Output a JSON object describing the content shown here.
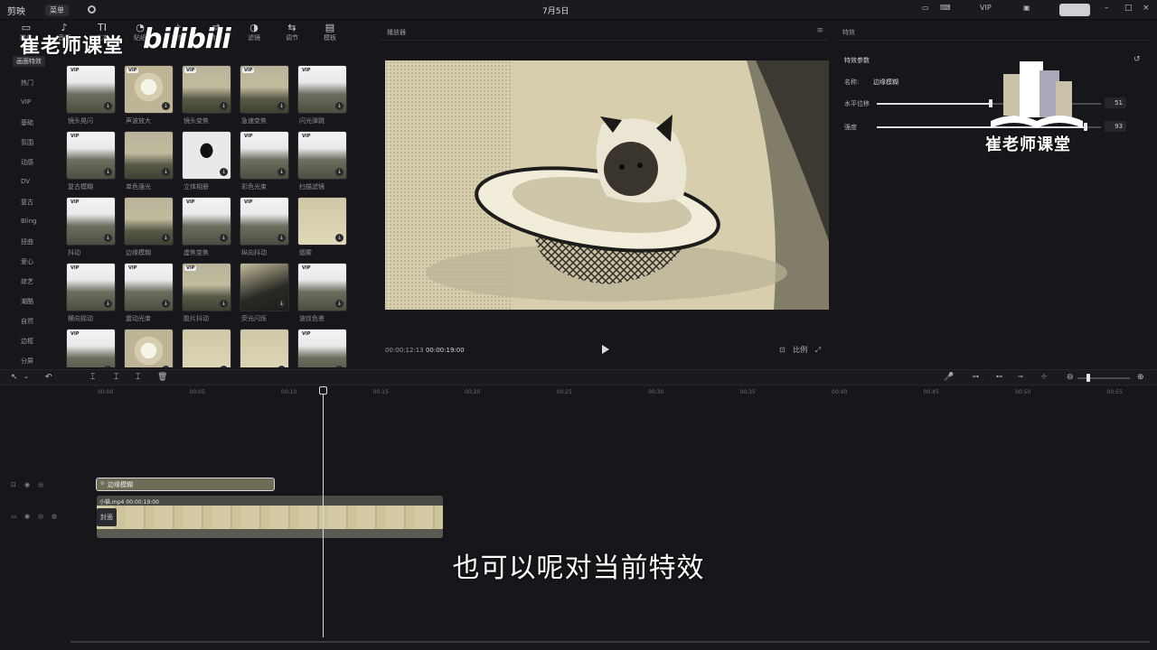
{
  "titlebar": {
    "app_name": "剪映",
    "menu_label": "菜单",
    "window_title": "7月5日",
    "vip_label": "VIP",
    "export_label": "",
    "minimize": "–",
    "maximize": "□",
    "close": "×"
  },
  "toolbar_tabs": [
    {
      "label": "媒体",
      "icon": "▭"
    },
    {
      "label": "音频",
      "icon": "♪"
    },
    {
      "label": "文本",
      "icon": "TI"
    },
    {
      "label": "贴纸",
      "icon": "◔"
    },
    {
      "label": "特效",
      "icon": "✧"
    },
    {
      "label": "转场",
      "icon": "⇄"
    },
    {
      "label": "滤镜",
      "icon": "◑"
    },
    {
      "label": "调节",
      "icon": "⇆"
    },
    {
      "label": "模板",
      "icon": "▤"
    }
  ],
  "watermark": {
    "left_text": "崔老师课堂",
    "bilibili": "bilibili",
    "right_text": "崔老师课堂"
  },
  "effects_nav": {
    "active": "画面特效",
    "items": [
      "热门",
      "VIP",
      "基础",
      "氛围",
      "动感",
      "DV",
      "复古",
      "Bling",
      "扭曲",
      "爱心",
      "综艺",
      "潮酷",
      "自然",
      "边框",
      "分屏"
    ]
  },
  "effect_cards": [
    {
      "name": "镜头晃闪",
      "vip": true,
      "thumb": "t-forest"
    },
    {
      "name": "声波放大",
      "vip": true,
      "thumb": "t-girl"
    },
    {
      "name": "镜头变焦",
      "vip": true,
      "thumb": "t-warm"
    },
    {
      "name": "急速变焦",
      "vip": true,
      "thumb": "t-warm"
    },
    {
      "name": "闪光弹跳",
      "vip": true,
      "thumb": "t-forest"
    },
    {
      "name": "复古模糊",
      "vip": true,
      "thumb": "t-forest"
    },
    {
      "name": "单色强光",
      "vip": false,
      "thumb": "t-warm"
    },
    {
      "name": "立体相册",
      "vip": false,
      "thumb": "t-bw"
    },
    {
      "name": "彩色光束",
      "vip": true,
      "thumb": "t-forest"
    },
    {
      "name": "扫描滤镜",
      "vip": true,
      "thumb": "t-forest"
    },
    {
      "name": "抖动",
      "vip": true,
      "thumb": "t-forest"
    },
    {
      "name": "边缘模糊",
      "vip": false,
      "thumb": "t-warm"
    },
    {
      "name": "虚焦变焦",
      "vip": true,
      "thumb": "t-forest"
    },
    {
      "name": "纵向抖动",
      "vip": true,
      "thumb": "t-forest"
    },
    {
      "name": "烟雾",
      "vip": false,
      "thumb": "t-cream"
    },
    {
      "name": "横向摇动",
      "vip": true,
      "thumb": "t-forest"
    },
    {
      "name": "震动光束",
      "vip": true,
      "thumb": "t-forest"
    },
    {
      "name": "胶片抖动",
      "vip": true,
      "thumb": "t-warm"
    },
    {
      "name": "荧光闪烁",
      "vip": false,
      "thumb": "t-dark"
    },
    {
      "name": "波纹色差",
      "vip": true,
      "thumb": "t-forest"
    },
    {
      "name": "",
      "vip": true,
      "thumb": "t-forest"
    },
    {
      "name": "",
      "vip": false,
      "thumb": "t-girl"
    },
    {
      "name": "",
      "vip": false,
      "thumb": "t-cream"
    },
    {
      "name": "",
      "vip": false,
      "thumb": "t-cream"
    },
    {
      "name": "",
      "vip": true,
      "thumb": "t-forest"
    }
  ],
  "player": {
    "title": "播放器",
    "menu_icon": "≡",
    "current_time": "00:00:12:13",
    "total_time": "00:00:19:00",
    "ratio_label": "比例"
  },
  "inspector": {
    "title": "特效",
    "section": "特效参数",
    "name_label": "名称:",
    "name_value": "边缘模糊",
    "params": [
      {
        "label": "水平位移",
        "value": "51",
        "level": 0.51
      },
      {
        "label": "强度",
        "value": "93",
        "level": 0.93
      }
    ]
  },
  "timeline": {
    "ticks": [
      "00:00",
      "00:05",
      "00:10",
      "00:15",
      "00:20",
      "00:25",
      "00:30",
      "00:35",
      "00:40",
      "00:45",
      "00:50",
      "00:55"
    ],
    "effect_clip": "边缘模糊",
    "video_clip_name": "小猫.mp4",
    "video_clip_duration": "00:00:19:00",
    "cover_label": "封面"
  },
  "subtitle": "也可以呢对当前特效",
  "colors": {
    "background": "#17171b",
    "panel": "#1b1b1f",
    "video_tint": "#d6ceac",
    "effect_clip": "#6e6b57"
  }
}
